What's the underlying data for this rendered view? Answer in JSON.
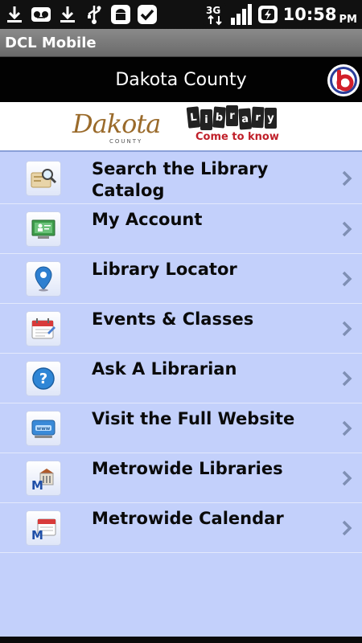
{
  "status_bar": {
    "time": "10:58",
    "ampm": "PM",
    "network": "3G",
    "icons": [
      "download-icon",
      "voicemail-icon",
      "download-icon",
      "usb-icon",
      "android-icon",
      "check-icon",
      "3g-icon",
      "signal-icon",
      "battery-charging-icon"
    ]
  },
  "app_bar": {
    "title": "DCL Mobile"
  },
  "header": {
    "title": "Dakota County"
  },
  "banner": {
    "dakota_logo_text": "Dakota",
    "dakota_logo_sub": "COUNTY",
    "library_tiles": [
      "L",
      "i",
      "b",
      "r",
      "a",
      "r",
      "y"
    ],
    "library_tagline": "Come to know"
  },
  "menu": {
    "items": [
      {
        "label": "Search the Library Catalog",
        "icon": "search-catalog-icon"
      },
      {
        "label": "My Account",
        "icon": "account-icon"
      },
      {
        "label": "Library Locator",
        "icon": "location-pin-icon"
      },
      {
        "label": "Events & Classes",
        "icon": "calendar-icon"
      },
      {
        "label": "Ask A Librarian",
        "icon": "help-icon"
      },
      {
        "label": "Visit the Full Website",
        "icon": "website-icon"
      },
      {
        "label": "Metrowide Libraries",
        "icon": "metro-library-icon"
      },
      {
        "label": "Metrowide Calendar",
        "icon": "metro-calendar-icon"
      }
    ]
  },
  "colors": {
    "list_background": "#c3d0fb",
    "header_background": "#020202",
    "tagline_red": "#c0202a",
    "dakota_brown": "#9a6a2a"
  }
}
